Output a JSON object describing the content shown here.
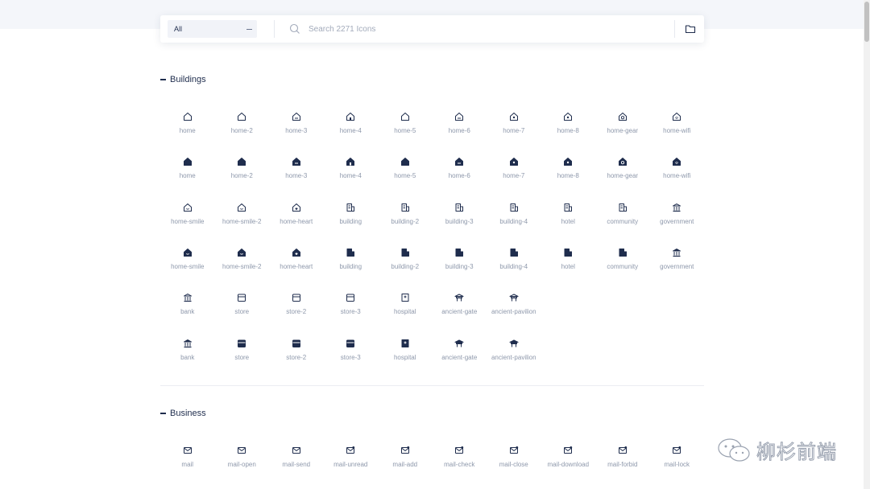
{
  "search": {
    "category_value": "All",
    "placeholder": "Search 2271 Icons"
  },
  "sections": [
    {
      "title": "Buildings",
      "rows": [
        [
          "home",
          "home-2",
          "home-3",
          "home-4",
          "home-5",
          "home-6",
          "home-7",
          "home-8",
          "home-gear",
          "home-wifi"
        ],
        [
          "home",
          "home-2",
          "home-3",
          "home-4",
          "home-5",
          "home-6",
          "home-7",
          "home-8",
          "home-gear",
          "home-wifi"
        ],
        [
          "home-smile",
          "home-smile-2",
          "home-heart",
          "building",
          "building-2",
          "building-3",
          "building-4",
          "hotel",
          "community",
          "government"
        ],
        [
          "home-smile",
          "home-smile-2",
          "home-heart",
          "building",
          "building-2",
          "building-3",
          "building-4",
          "hotel",
          "community",
          "government"
        ],
        [
          "bank",
          "store",
          "store-2",
          "store-3",
          "hospital",
          "ancient-gate",
          "ancient-pavilion"
        ],
        [
          "bank",
          "store",
          "store-2",
          "store-3",
          "hospital",
          "ancient-gate",
          "ancient-pavilion"
        ]
      ],
      "row_styles": [
        "line",
        "fill",
        "line",
        "fill",
        "line",
        "fill"
      ]
    },
    {
      "title": "Business",
      "rows": [
        [
          "mail",
          "mail-open",
          "mail-send",
          "mail-unread",
          "mail-add",
          "mail-check",
          "mail-close",
          "mail-download",
          "mail-forbid",
          "mail-lock"
        ]
      ],
      "row_styles": [
        "line"
      ]
    }
  ],
  "watermark": {
    "text": "柳杉前端",
    "icon": "wechat-icon"
  },
  "colors": {
    "icon": "#1f2d4d",
    "label": "#8e98ab",
    "top_band": "#f4f6fa"
  }
}
